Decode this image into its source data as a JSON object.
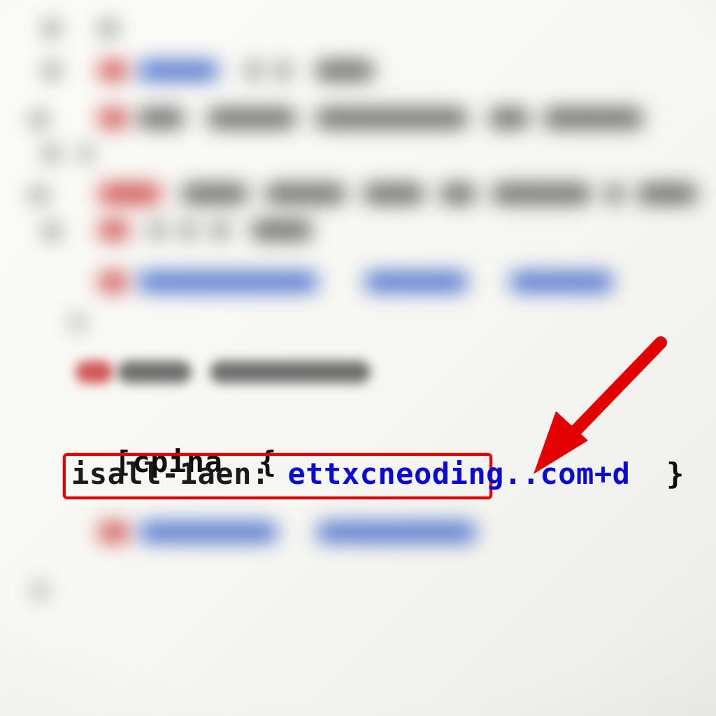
{
  "code": {
    "selector_line": "[cpina  {",
    "rule": {
      "property": "isall-1aen:",
      "space": " ",
      "value": "ettxcneoding..com+d",
      "trail": "  }"
    }
  },
  "annotation": {
    "arrow_target": "rule-box"
  }
}
